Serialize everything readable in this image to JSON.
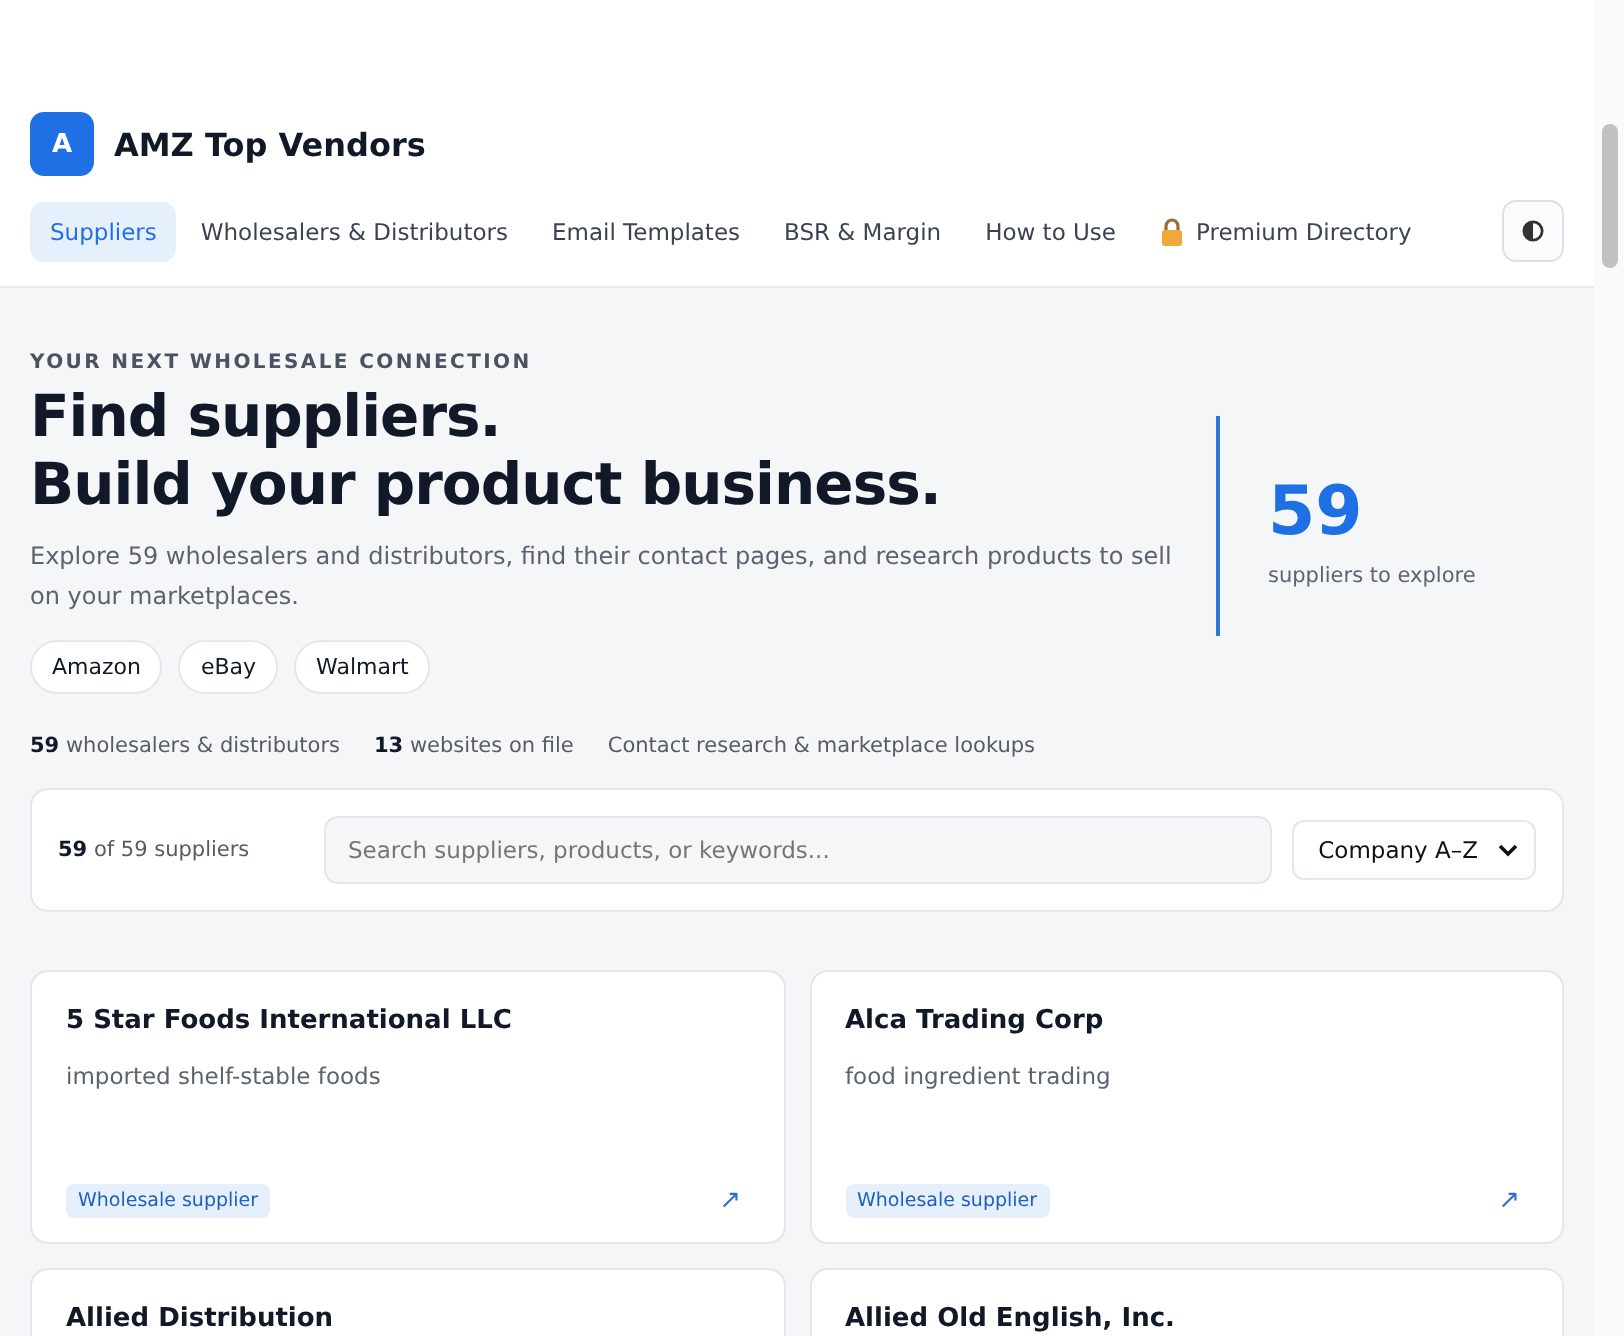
{
  "brand": {
    "logo_letter": "A",
    "name": "AMZ Top Vendors"
  },
  "nav": [
    {
      "label": "Suppliers",
      "selected": true,
      "locked": false
    },
    {
      "label": "Wholesalers & Distributors",
      "selected": false,
      "locked": false
    },
    {
      "label": "Email Templates",
      "selected": false,
      "locked": false
    },
    {
      "label": "BSR & Margin",
      "selected": false,
      "locked": false
    },
    {
      "label": "How to Use",
      "selected": false,
      "locked": false
    },
    {
      "label": "Premium Directory",
      "selected": false,
      "locked": true
    }
  ],
  "hero": {
    "eyebrow": "YOUR NEXT WHOLESALE CONNECTION",
    "title_lines": [
      "Find suppliers.",
      "Build your product business."
    ],
    "description": "Explore 59 wholesalers and distributors, find their contact pages, and research products to sell on your marketplaces.",
    "marketplaces": [
      "Amazon",
      "eBay",
      "Walmart"
    ],
    "stats": [
      "**59** wholesalers & distributors",
      "**13** websites on file",
      "Contact research & marketplace lookups"
    ],
    "highlight": {
      "value": "59",
      "label": "suppliers to explore"
    }
  },
  "toolbar": {
    "count": "**59** of 59 suppliers",
    "search": {
      "placeholder": "Search suppliers, products, or keywords..."
    },
    "sort": "Company A–Z"
  },
  "suppliers": [
    {
      "name": "5 Star Foods International LLC",
      "description": "imported shelf-stable foods",
      "tag": "Wholesale supplier",
      "link": "↗"
    },
    {
      "name": "Alca Trading Corp",
      "description": "food ingredient trading",
      "tag": "Wholesale supplier",
      "link": "↗"
    },
    {
      "name": "Allied Distribution"
    },
    {
      "name": "Allied Old English, Inc."
    }
  ]
}
